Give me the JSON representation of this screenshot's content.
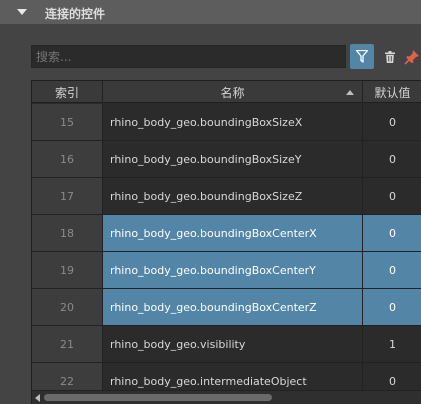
{
  "panel": {
    "title": "连接的控件"
  },
  "search": {
    "placeholder": "搜索..."
  },
  "icons": {
    "caret": "caret-down-icon",
    "filter": "filter-icon",
    "trash": "trash-icon",
    "pin": "pin-icon",
    "sort": "sort-ascending-icon"
  },
  "colors": {
    "selection": "#5285a6",
    "pin_accent": "#e0624a"
  },
  "table": {
    "columns": [
      "索引",
      "名称",
      "默认值"
    ],
    "rows": [
      {
        "index": "15",
        "name": "rhino_body_geo.boundingBoxSizeX",
        "default": "0",
        "selected": false
      },
      {
        "index": "16",
        "name": "rhino_body_geo.boundingBoxSizeY",
        "default": "0",
        "selected": false
      },
      {
        "index": "17",
        "name": "rhino_body_geo.boundingBoxSizeZ",
        "default": "0",
        "selected": false
      },
      {
        "index": "18",
        "name": "rhino_body_geo.boundingBoxCenterX",
        "default": "0",
        "selected": true
      },
      {
        "index": "19",
        "name": "rhino_body_geo.boundingBoxCenterY",
        "default": "0",
        "selected": true
      },
      {
        "index": "20",
        "name": "rhino_body_geo.boundingBoxCenterZ",
        "default": "0",
        "selected": true
      },
      {
        "index": "21",
        "name": "rhino_body_geo.visibility",
        "default": "1",
        "selected": false
      },
      {
        "index": "22",
        "name": "rhino_body_geo.intermediateObject",
        "default": "0",
        "selected": false
      }
    ]
  }
}
